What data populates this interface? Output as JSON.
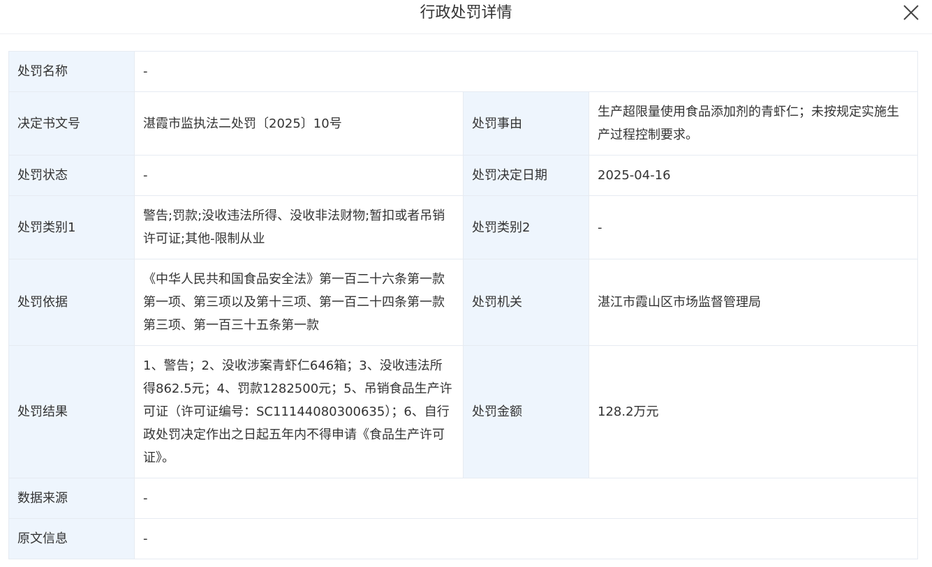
{
  "header": {
    "title": "行政处罚详情",
    "close_icon": "close-icon"
  },
  "rows": {
    "penalty_name": {
      "label": "处罚名称",
      "value": "-"
    },
    "decision_no": {
      "label": "决定书文号",
      "value": "湛霞市监执法二处罚〔2025〕10号"
    },
    "reason": {
      "label": "处罚事由",
      "value": "生产超限量使用食品添加剂的青虾仁；未按规定实施生产过程控制要求。"
    },
    "status": {
      "label": "处罚状态",
      "value": "-"
    },
    "decision_date": {
      "label": "处罚决定日期",
      "value": "2025-04-16"
    },
    "category1": {
      "label": "处罚类别1",
      "value": "警告;罚款;没收违法所得、没收非法财物;暂扣或者吊销许可证;其他-限制从业"
    },
    "category2": {
      "label": "处罚类别2",
      "value": "-"
    },
    "basis": {
      "label": "处罚依据",
      "value": "《中华人民共和国食品安全法》第一百二十六条第一款第一项、第三项以及第十三项、第一百二十四条第一款第三项、第一百三十五条第一款"
    },
    "authority": {
      "label": "处罚机关",
      "value": "湛江市霞山区市场监督管理局"
    },
    "result": {
      "label": "处罚结果",
      "value": "1、警告；2、没收涉案青虾仁646箱；3、没收违法所得862.5元；4、罚款1282500元；5、吊销食品生产许可证（许可证编号：SC11144080300635）；6、自行政处罚决定作出之日起五年内不得申请《食品生产许可证》。"
    },
    "amount": {
      "label": "处罚金额",
      "value": "128.2万元"
    },
    "source": {
      "label": "数据来源",
      "value": "-"
    },
    "original": {
      "label": "原文信息",
      "value": "-"
    }
  }
}
